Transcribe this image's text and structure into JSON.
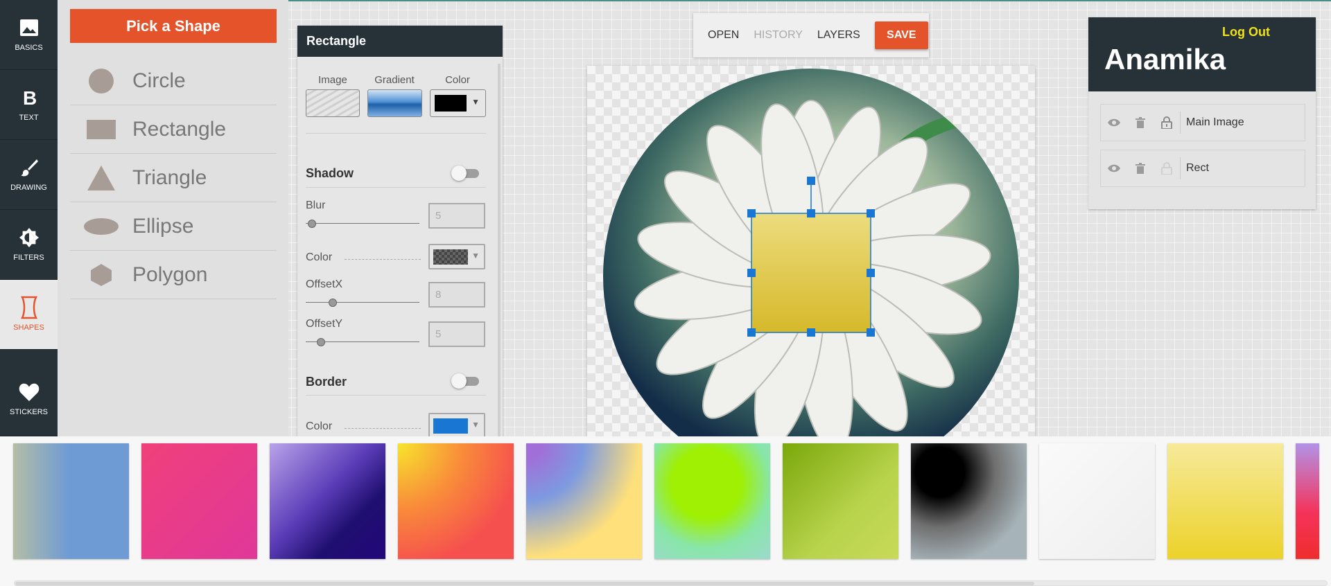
{
  "nav": [
    {
      "label": "BASICS",
      "icon": "image-icon",
      "active": false
    },
    {
      "label": "TEXT",
      "icon": "bold-b-icon",
      "active": false
    },
    {
      "label": "DRAWING",
      "icon": "brush-icon",
      "active": false
    },
    {
      "label": "FILTERS",
      "icon": "brightness-icon",
      "active": false
    },
    {
      "label": "SHAPES",
      "icon": "shapes-icon",
      "active": true
    },
    {
      "label": "STICKERS",
      "icon": "heart-icon",
      "active": false
    }
  ],
  "shapes": {
    "button": "Pick a Shape",
    "items": [
      {
        "label": "Circle",
        "icon": "circle-icon"
      },
      {
        "label": "Rectangle",
        "icon": "rectangle-icon"
      },
      {
        "label": "Triangle",
        "icon": "triangle-icon"
      },
      {
        "label": "Ellipse",
        "icon": "ellipse-icon"
      },
      {
        "label": "Polygon",
        "icon": "polygon-icon"
      }
    ]
  },
  "props": {
    "title": "Rectangle",
    "fill_tabs": [
      "Image",
      "Gradient",
      "Color"
    ],
    "fill_color": "#000000",
    "shadow": {
      "title": "Shadow",
      "enabled": false,
      "blur_label": "Blur",
      "blur": "5",
      "color_label": "Color",
      "offsetx_label": "OffsetX",
      "offsetx": "8",
      "offsety_label": "OffsetY",
      "offsety": "5"
    },
    "border": {
      "title": "Border",
      "enabled": false,
      "color_label": "Color",
      "color": "#1976d2"
    }
  },
  "toolbar": {
    "open": "OPEN",
    "history": "HISTORY",
    "layers": "LAYERS",
    "save": "SAVE"
  },
  "user": {
    "logout": "Log Out",
    "name": "Anamika",
    "layers": [
      {
        "name": "Main Image",
        "locked": true
      },
      {
        "name": "Rect",
        "locked": false
      }
    ]
  },
  "colors": {
    "accent": "#e4532a",
    "dark": "#263238",
    "selection": "#1976d2",
    "rect_fill": "#e2c63a"
  },
  "gradients": [
    "gradient-grey-blue",
    "gradient-pink",
    "gradient-purple-navy",
    "gradient-yellow-red-radial",
    "gradient-purple-yellow-radial",
    "gradient-green-teal-radial",
    "gradient-olive-lime",
    "gradient-black-grey-radial",
    "gradient-white",
    "gradient-light-yellow",
    "gradient-purple-red"
  ]
}
